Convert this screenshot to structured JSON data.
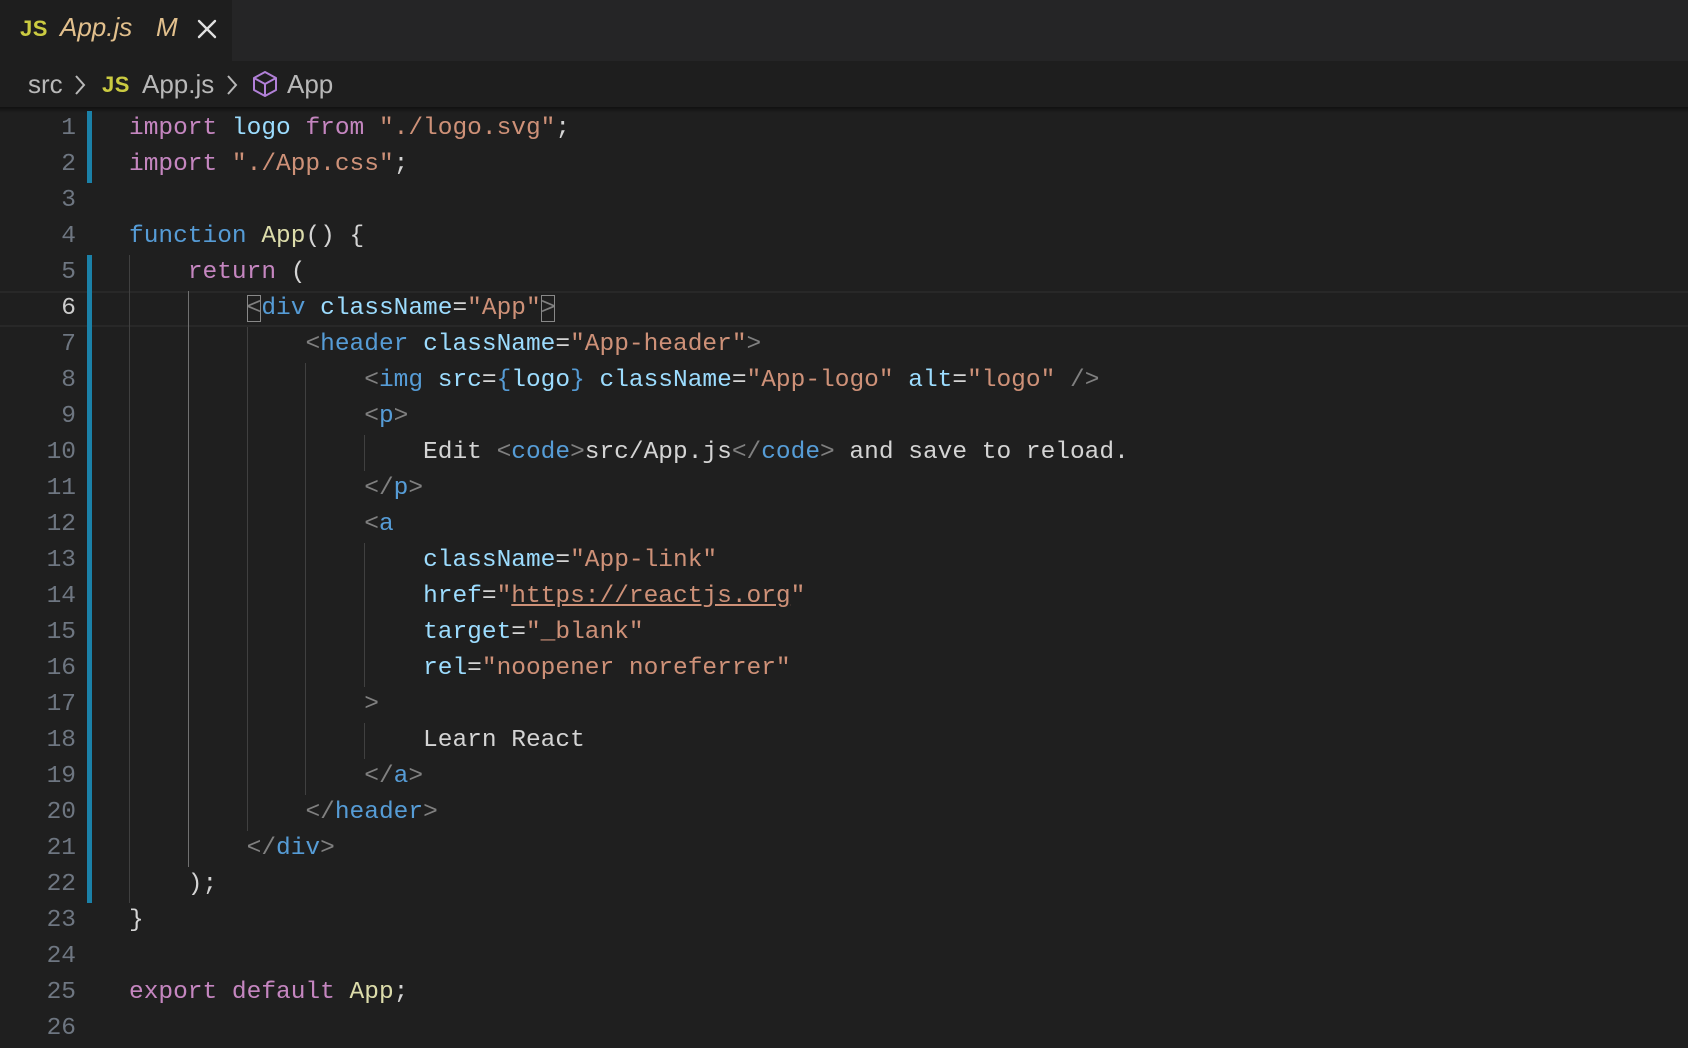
{
  "tab": {
    "language_badge": "JS",
    "title": "App.js",
    "status": "M"
  },
  "breadcrumbs": {
    "folder": "src",
    "file_badge": "JS",
    "file": "App.js",
    "symbol": "App"
  },
  "editor": {
    "current_line": 6,
    "lines": [
      {
        "n": "1",
        "html": "<span class=\"kw\">import</span> <span class=\"var\">logo</span> <span class=\"kw\">from</span> <span class=\"str\">\"./logo.svg\"</span>;"
      },
      {
        "n": "2",
        "html": "<span class=\"kw\">import</span> <span class=\"str\">\"./App.css\"</span>;"
      },
      {
        "n": "3",
        "html": ""
      },
      {
        "n": "4",
        "html": "<span class=\"st\">function</span> <span class=\"fn\">App</span>() {"
      },
      {
        "n": "5",
        "html": "    <span class=\"kw\">return</span> ("
      },
      {
        "n": "6",
        "html": "        <span class=\"br mbox\">&lt;</span><span class=\"tag\">div</span> <span class=\"attr\">className</span>=<span class=\"str\">\"App\"</span><span class=\"br mbox\">&gt;</span>"
      },
      {
        "n": "7",
        "html": "            <span class=\"br\">&lt;</span><span class=\"tag\">header</span> <span class=\"attr\">className</span>=<span class=\"str\">\"App-header\"</span><span class=\"br\">&gt;</span>"
      },
      {
        "n": "8",
        "html": "                <span class=\"br\">&lt;</span><span class=\"tag\">img</span> <span class=\"attr\">src</span>=<span class=\"st\">{</span><span class=\"var\">logo</span><span class=\"st\">}</span> <span class=\"attr\">className</span>=<span class=\"str\">\"App-logo\"</span> <span class=\"attr\">alt</span>=<span class=\"str\">\"logo\"</span> <span class=\"br\">/&gt;</span>"
      },
      {
        "n": "9",
        "html": "                <span class=\"br\">&lt;</span><span class=\"tag\">p</span><span class=\"br\">&gt;</span>"
      },
      {
        "n": "10",
        "html": "                    Edit <span class=\"br\">&lt;</span><span class=\"tag\">code</span><span class=\"br\">&gt;</span>src/App.js<span class=\"br\">&lt;/</span><span class=\"tag\">code</span><span class=\"br\">&gt;</span> and save to reload."
      },
      {
        "n": "11",
        "html": "                <span class=\"br\">&lt;/</span><span class=\"tag\">p</span><span class=\"br\">&gt;</span>"
      },
      {
        "n": "12",
        "html": "                <span class=\"br\">&lt;</span><span class=\"tag\">a</span>"
      },
      {
        "n": "13",
        "html": "                    <span class=\"attr\">className</span>=<span class=\"str\">\"App-link\"</span>"
      },
      {
        "n": "14",
        "html": "                    <span class=\"attr\">href</span>=<span class=\"str\">\"</span><span class=\"url\">https://reactjs.org</span><span class=\"str\">\"</span>"
      },
      {
        "n": "15",
        "html": "                    <span class=\"attr\">target</span>=<span class=\"str\">\"_blank\"</span>"
      },
      {
        "n": "16",
        "html": "                    <span class=\"attr\">rel</span>=<span class=\"str\">\"noopener noreferrer\"</span>"
      },
      {
        "n": "17",
        "html": "                <span class=\"br\">&gt;</span>"
      },
      {
        "n": "18",
        "html": "                    Learn React"
      },
      {
        "n": "19",
        "html": "                <span class=\"br\">&lt;/</span><span class=\"tag\">a</span><span class=\"br\">&gt;</span>"
      },
      {
        "n": "20",
        "html": "            <span class=\"br\">&lt;/</span><span class=\"tag\">header</span><span class=\"br\">&gt;</span>"
      },
      {
        "n": "21",
        "html": "        <span class=\"br\">&lt;/</span><span class=\"tag\">div</span><span class=\"br\">&gt;</span>"
      },
      {
        "n": "22",
        "html": "    );"
      },
      {
        "n": "23",
        "html": "}"
      },
      {
        "n": "24",
        "html": ""
      },
      {
        "n": "25",
        "html": "<span class=\"kw\">export</span> <span class=\"kw\">default</span> <span class=\"fn\">App</span>;"
      },
      {
        "n": "26",
        "html": ""
      }
    ],
    "modified_ranges": [
      [
        1,
        2
      ],
      [
        5,
        22
      ]
    ]
  }
}
